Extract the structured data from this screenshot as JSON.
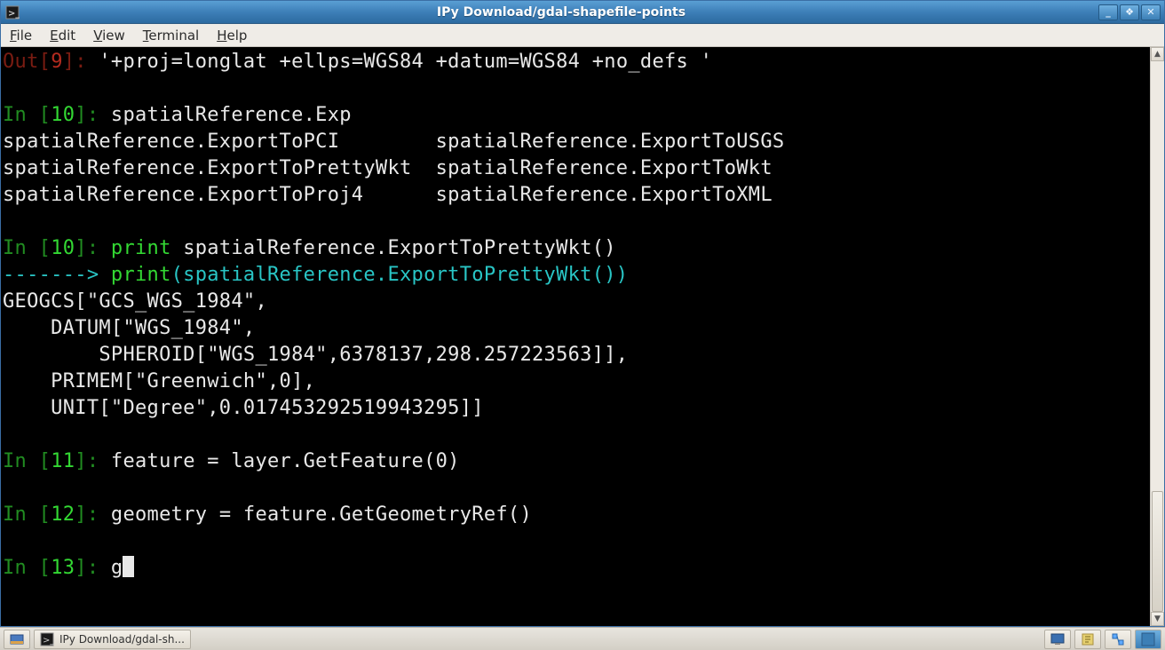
{
  "window": {
    "title": "IPy Download/gdal-shapefile-points",
    "min_tip": "_",
    "max_tip": "❖",
    "close_tip": "✕"
  },
  "menubar": {
    "items": [
      {
        "accel": "F",
        "rest": "ile"
      },
      {
        "accel": "E",
        "rest": "dit"
      },
      {
        "accel": "V",
        "rest": "iew"
      },
      {
        "accel": "T",
        "rest": "erminal"
      },
      {
        "accel": "H",
        "rest": "elp"
      }
    ]
  },
  "terminal": {
    "out9_prefix": "Out[",
    "out9_num": "9",
    "out9_suffix": "]:",
    "out9_value": " '+proj=longlat +ellps=WGS84 +datum=WGS84 +no_defs '",
    "in10a_prefix": "In [",
    "in10a_num": "10",
    "in10a_suffix": "]:",
    "in10a_body": " spatialReference.Exp",
    "compl_l1": "spatialReference.ExportToPCI        spatialReference.ExportToUSGS",
    "compl_l2": "spatialReference.ExportToPrettyWkt  spatialReference.ExportToWkt",
    "compl_l3": "spatialReference.ExportToProj4      spatialReference.ExportToXML",
    "in10b_prefix": "In [",
    "in10b_num": "10",
    "in10b_suffix": "]:",
    "in10b_body1": " ",
    "in10b_body2": "print",
    "in10b_body3": " spatialReference.ExportToPrettyWkt()",
    "arrow": "-------> ",
    "arrow_body1": "print",
    "arrow_body2": "(spatialReference.ExportToPrettyWkt())",
    "wkt_l1": "GEOGCS[\"GCS_WGS_1984\",",
    "wkt_l2": "    DATUM[\"WGS_1984\",",
    "wkt_l3": "        SPHEROID[\"WGS_1984\",6378137,298.257223563]],",
    "wkt_l4": "    PRIMEM[\"Greenwich\",0],",
    "wkt_l5": "    UNIT[\"Degree\",0.017453292519943295]]",
    "in11_prefix": "In [",
    "in11_num": "11",
    "in11_suffix": "]:",
    "in11_body": " feature = layer.GetFeature(0)",
    "in12_prefix": "In [",
    "in12_num": "12",
    "in12_suffix": "]:",
    "in12_body": " geometry = feature.GetGeometryRef()",
    "in13_prefix": "In [",
    "in13_num": "13",
    "in13_suffix": "]:",
    "in13_body": " g"
  },
  "taskbar": {
    "task1_label": "IPy Download/gdal-sh..."
  }
}
